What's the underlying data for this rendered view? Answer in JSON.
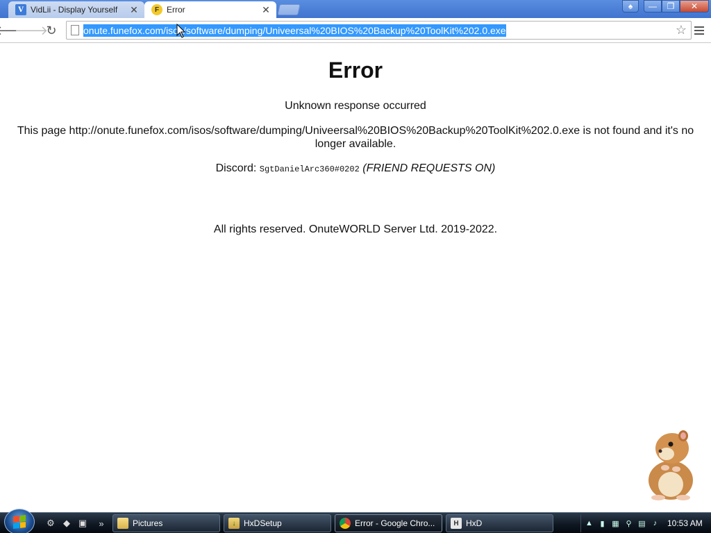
{
  "browser": {
    "tabs": [
      {
        "title": "VidLii - Display Yourself",
        "icon": "vidlii-icon",
        "active": false
      },
      {
        "title": "Error",
        "icon": "fox-icon",
        "active": true
      }
    ],
    "url": "onute.funefox.com/isos/software/dumping/Univeersal%20BIOS%20Backup%20ToolKit%202.0.exe"
  },
  "page": {
    "heading": "Error",
    "subheading": "Unknown response occurred",
    "not_found": "This page http://onute.funefox.com/isos/software/dumping/Univeersal%20BIOS%20Backup%20ToolKit%202.0.exe is not found and it's no longer available.",
    "discord_label": "Discord:",
    "discord_handle": "SgtDanielArc360#0202",
    "discord_note": "(FRIEND REQUESTS ON)",
    "rights": "All rights reserved. OnuteWORLD Server Ltd. 2019-2022."
  },
  "taskbar": {
    "tasks": [
      {
        "label": "Pictures",
        "icon": "folder-icon"
      },
      {
        "label": "HxDSetup",
        "icon": "hxd-setup-icon"
      },
      {
        "label": "Error - Google Chro...",
        "icon": "chrome-icon",
        "active": true
      },
      {
        "label": "HxD",
        "icon": "hxd-icon"
      }
    ],
    "clock": "10:53 AM"
  },
  "colors": {
    "selection": "#3399ff",
    "tabstrip": "#4a7fd6"
  }
}
